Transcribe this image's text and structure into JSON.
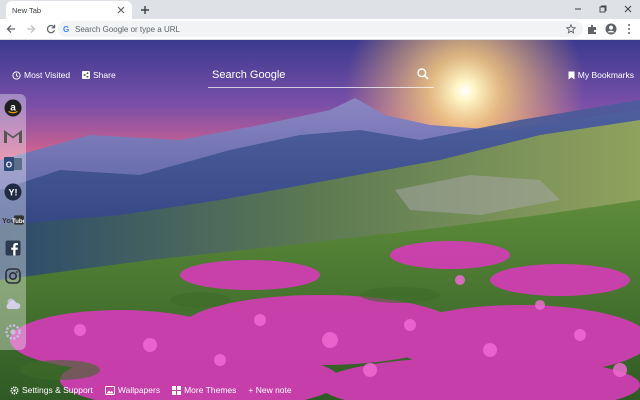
{
  "browser": {
    "tab_title": "New Tab",
    "omnibox_placeholder": "Search Google or type a URL"
  },
  "newtab": {
    "most_visited_label": "Most Visited",
    "share_label": "Share",
    "search_placeholder": "Search Google",
    "bookmarks_label": "My Bookmarks"
  },
  "sidebar": {
    "items": [
      {
        "icon": "amazon-icon"
      },
      {
        "icon": "gmail-icon"
      },
      {
        "icon": "outlook-icon"
      },
      {
        "icon": "yahoo-icon"
      },
      {
        "icon": "youtube-icon",
        "label": "YouTube"
      },
      {
        "icon": "facebook-icon"
      },
      {
        "icon": "instagram-icon"
      },
      {
        "icon": "weather-icon"
      },
      {
        "icon": "settings-icon"
      }
    ]
  },
  "bottombar": {
    "settings_label": "Settings & Support",
    "wallpapers_label": "Wallpapers",
    "themes_label": "More Themes",
    "new_note_label": "+ New note"
  },
  "colors": {
    "tab_strip": "#dee1e6",
    "toolbar": "#ffffff",
    "omnibox": "#f1f3f4",
    "google_blue": "#4285f4",
    "text_white": "#ffffff"
  }
}
